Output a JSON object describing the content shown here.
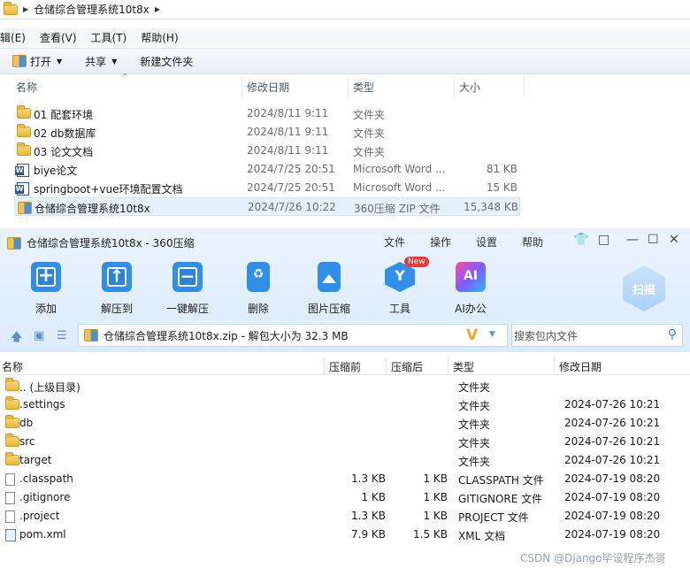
{
  "explorer": {
    "breadcrumb": "仓储综合管理系统10t8x",
    "menu": [
      "编辑(E)",
      "查看(V)",
      "工具(T)",
      "帮助(H)"
    ],
    "toolbar": {
      "open": "打开",
      "share": "共享",
      "new_folder": "新建文件夹"
    },
    "columns": {
      "name": "名称",
      "date": "修改日期",
      "type": "类型",
      "size": "大小"
    },
    "rows": [
      {
        "name": "01 配套环境",
        "date": "2024/8/11 9:11",
        "type": "文件夹",
        "size": "",
        "icon": "folder-icon"
      },
      {
        "name": "02 db数据库",
        "date": "2024/8/11 9:11",
        "type": "文件夹",
        "size": "",
        "icon": "folder-icon"
      },
      {
        "name": "03 论文文档",
        "date": "2024/8/11 9:11",
        "type": "文件夹",
        "size": "",
        "icon": "folder-icon"
      },
      {
        "name": "biye论文",
        "date": "2024/7/25 20:51",
        "type": "Microsoft Word ...",
        "size": "81 KB",
        "icon": "word-icon"
      },
      {
        "name": "springboot+vue环境配置文档",
        "date": "2024/7/25 20:51",
        "type": "Microsoft Word ...",
        "size": "15 KB",
        "icon": "word-icon"
      },
      {
        "name": "仓储综合管理系统10t8x",
        "date": "2024/7/26 10:22",
        "type": "360压缩 ZIP 文件",
        "size": "15,348 KB",
        "icon": "zip-icon"
      }
    ]
  },
  "zip": {
    "title": "仓储综合管理系统10t8x - 360压缩",
    "menu": [
      "文件",
      "操作",
      "设置",
      "帮助"
    ],
    "tools": [
      "添加",
      "解压到",
      "一键解压",
      "删除",
      "图片压缩",
      "工具",
      "AI办公"
    ],
    "new_badge": "New",
    "scan": "扫描",
    "path": "仓储综合管理系统10t8x.zip - 解包大小为 32.3 MB",
    "search_placeholder": "搜索包内文件",
    "columns": {
      "name": "名称",
      "before": "压缩前",
      "after": "压缩后",
      "type": "类型",
      "date": "修改日期"
    },
    "rows": [
      {
        "name": ".. (上级目录)",
        "before": "",
        "after": "",
        "type": "文件夹",
        "date": "",
        "icon": "folder-icon"
      },
      {
        "name": ".settings",
        "before": "",
        "after": "",
        "type": "文件夹",
        "date": "2024-07-26 10:21",
        "icon": "folder-icon"
      },
      {
        "name": "db",
        "before": "",
        "after": "",
        "type": "文件夹",
        "date": "2024-07-26 10:21",
        "icon": "folder-icon"
      },
      {
        "name": "src",
        "before": "",
        "after": "",
        "type": "文件夹",
        "date": "2024-07-26 10:21",
        "icon": "folder-icon"
      },
      {
        "name": "target",
        "before": "",
        "after": "",
        "type": "文件夹",
        "date": "2024-07-26 10:21",
        "icon": "folder-icon"
      },
      {
        "name": ".classpath",
        "before": "1.3 KB",
        "after": "1 KB",
        "type": "CLASSPATH 文件",
        "date": "2024-07-19 08:20",
        "icon": "file-icon"
      },
      {
        "name": ".gitignore",
        "before": "1 KB",
        "after": "1 KB",
        "type": "GITIGNORE 文件",
        "date": "2024-07-19 08:20",
        "icon": "file-icon"
      },
      {
        "name": ".project",
        "before": "1.3 KB",
        "after": "1 KB",
        "type": "PROJECT 文件",
        "date": "2024-07-19 08:20",
        "icon": "file-icon"
      },
      {
        "name": "pom.xml",
        "before": "7.9 KB",
        "after": "1.5 KB",
        "type": "XML 文档",
        "date": "2024-07-19 08:20",
        "icon": "xml-icon"
      }
    ]
  },
  "watermark": "CSDN @Django毕设程序杰哥"
}
